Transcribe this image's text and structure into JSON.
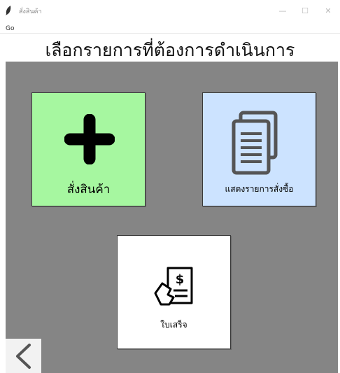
{
  "window": {
    "title": "สั่งสินค้า",
    "minimize_glyph": "—",
    "maximize_glyph": "☐",
    "close_glyph": "✕"
  },
  "menubar": {
    "items": [
      "Go"
    ]
  },
  "heading": "เลือกรายการที่ต้องการดำเนินการ",
  "tiles": {
    "order": {
      "label": "สั่งสินค้า",
      "icon": "plus-icon",
      "color": "#a6f7a0"
    },
    "orders_list": {
      "label": "แสดงรายการสั่งซื้อ",
      "icon": "documents-icon",
      "color": "#cce3ff"
    },
    "receipt": {
      "label": "ใบเสร็จ",
      "icon": "receipt-payment-icon",
      "color": "#ffffff"
    }
  },
  "back_button": {
    "icon": "chevron-left-icon"
  },
  "colors": {
    "panel_background": "#858585"
  }
}
